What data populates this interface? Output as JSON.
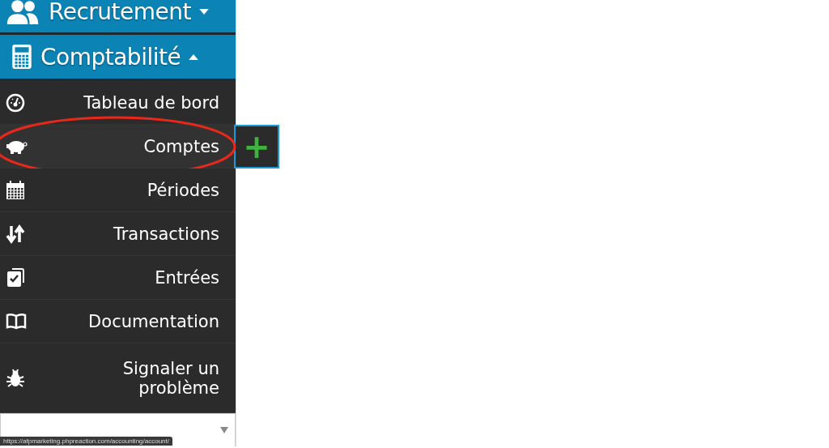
{
  "sections": [
    {
      "label": "Recrutement",
      "expanded": false,
      "kind": "users"
    },
    {
      "label": "Comptabilité",
      "expanded": true,
      "kind": "calculator"
    }
  ],
  "menu_items": [
    {
      "label": "Tableau de bord",
      "kind": "gauge",
      "selected": false
    },
    {
      "label": "Comptes",
      "kind": "piggy",
      "selected": true
    },
    {
      "label": "Périodes",
      "kind": "calendar",
      "selected": false
    },
    {
      "label": "Transactions",
      "kind": "arrows",
      "selected": false
    },
    {
      "label": "Entrées",
      "kind": "check",
      "selected": false
    },
    {
      "label": "Documentation",
      "kind": "book",
      "selected": false
    },
    {
      "label": "Signaler un problème",
      "kind": "bug",
      "selected": false
    }
  ],
  "add_button": {
    "label": "+"
  },
  "status_bar": {
    "url": "https://afpmarketing.phpreaction.com/accounting/account/"
  }
}
